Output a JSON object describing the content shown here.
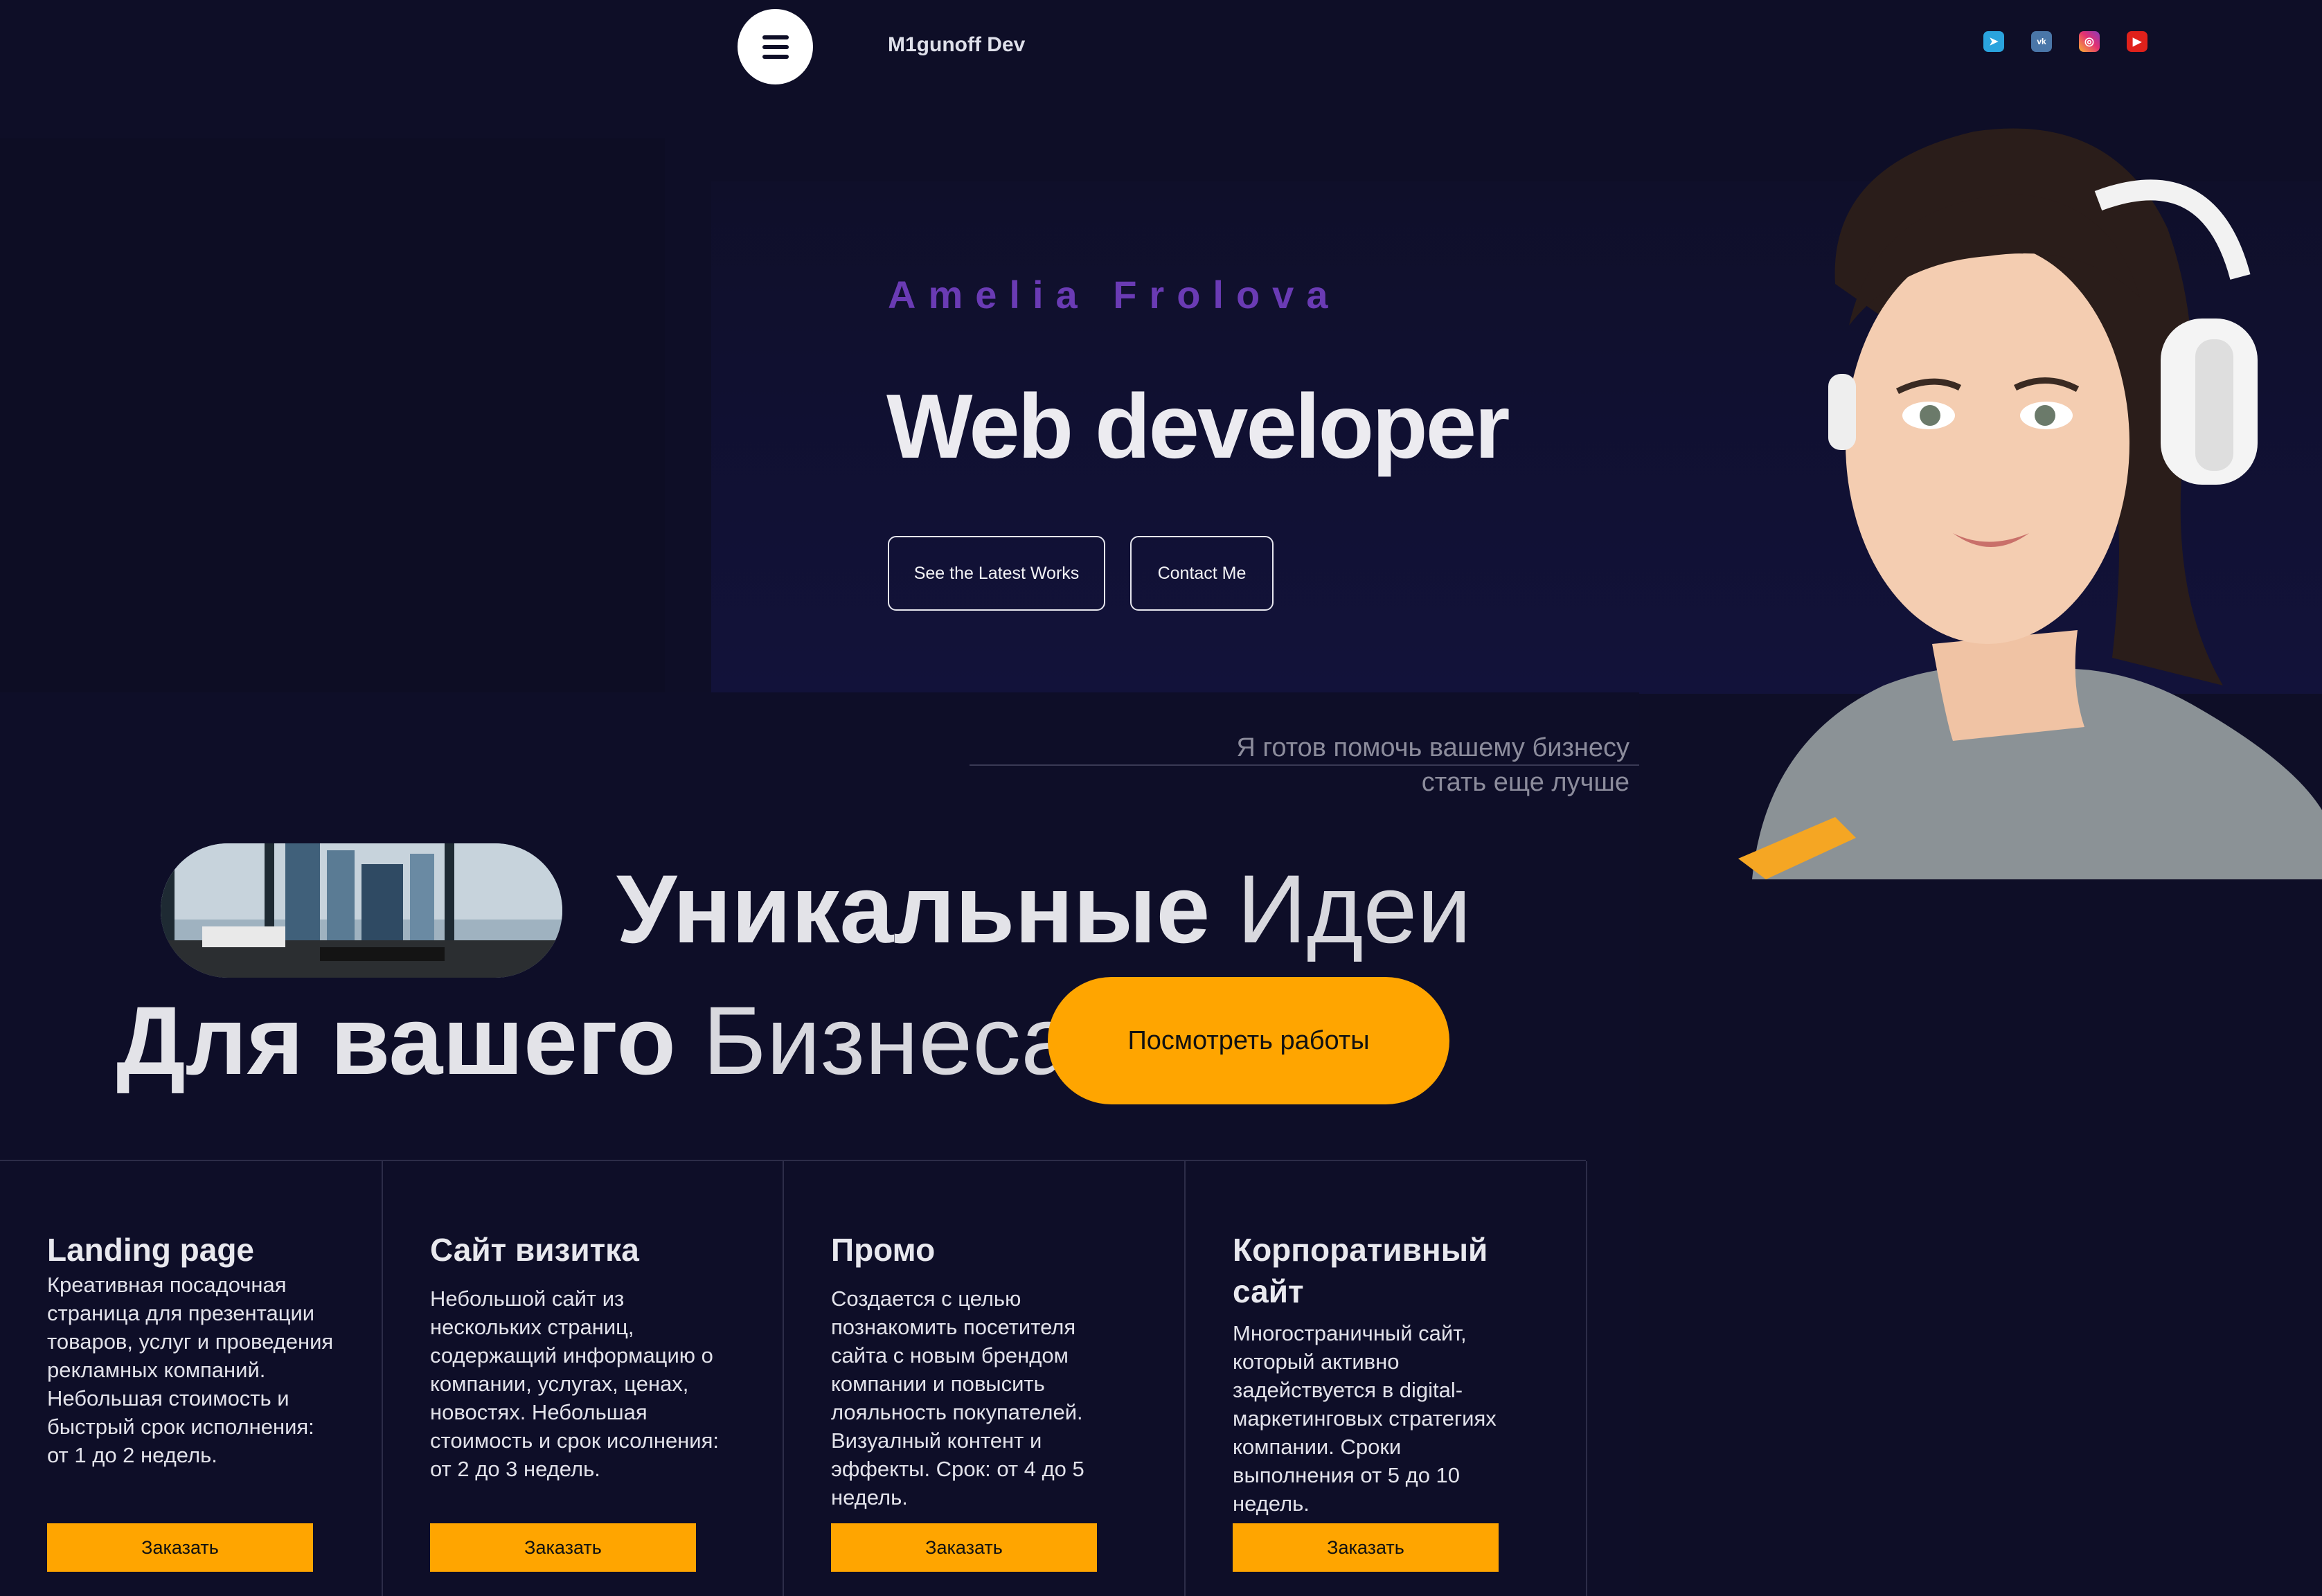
{
  "header": {
    "logo": "M1gunoff Dev",
    "menu_icon": "hamburger-icon",
    "socials": [
      {
        "name": "telegram-icon",
        "glyph": "➤"
      },
      {
        "name": "vk-icon",
        "glyph": "vk"
      },
      {
        "name": "instagram-icon",
        "glyph": "◎"
      },
      {
        "name": "youtube-icon",
        "glyph": "▶"
      }
    ]
  },
  "hero": {
    "name": "Amelia Frolova",
    "role": "Web developer",
    "btn_works": "See the Latest Works",
    "btn_contact": "Contact Me"
  },
  "intro": {
    "tagline_1": "Я готов помочь вашему бизнесу",
    "tagline_2": "стать еще лучше",
    "headline_1_bold": "Уникальные",
    "headline_1_light": "Идеи",
    "headline_2_bold": "Для вашего",
    "headline_2_light": "Бизнеса",
    "cta": "Посмотреть работы"
  },
  "services": [
    {
      "title": "Landing page",
      "text": "Креативная посадочная страница для презентации товаров, услуг и проведения рекламных компаний. Небольшая стоимость и быстрый срок исполнения: от 1 до 2 недель.",
      "button": "Заказать"
    },
    {
      "title": "Сайт визитка",
      "text": "Небольшой сайт из нескольких страниц, содержащий информацию о компании, услугах, ценах, новостях. Небольшая стоимость и срок исолнения: от 2 до 3 недель.",
      "button": "Заказать"
    },
    {
      "title": "Промо",
      "text": "Создается с целью познакомить посетителя сайта с новым брендом компании и повысить лояльность покупателей. Визуалный контент и эффекты. Срок: от 4 до 5 недель.",
      "button": "Заказать"
    },
    {
      "title": "Корпоративный сайт",
      "text": "Многостраничный сайт, который активно задействуется в digital-маркетинговых стратегиях компании. Сроки выполнения от 5 до 10 недель.",
      "button": "Заказать"
    }
  ],
  "colors": {
    "accent": "#ffa500",
    "name_purple": "#6a3bb4",
    "background": "#0e0e27"
  }
}
